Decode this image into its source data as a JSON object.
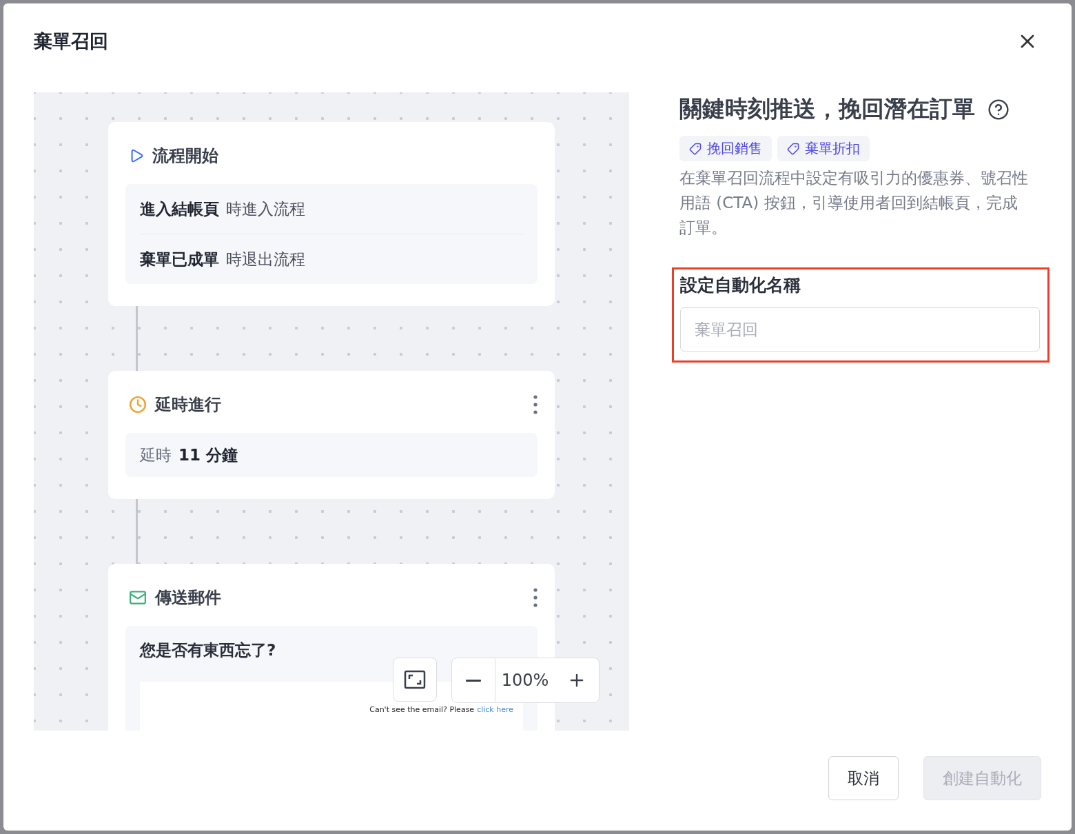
{
  "dialog": {
    "title": "棄單召回"
  },
  "flow": {
    "steps": [
      {
        "kind": "trigger",
        "title": "流程開始",
        "has_menu": false,
        "conditions": [
          {
            "bold": "進入結帳頁",
            "text": "時進入流程"
          },
          {
            "bold": "棄單已成單",
            "text": "時退出流程"
          }
        ]
      },
      {
        "kind": "delay",
        "title": "延時進行",
        "has_menu": true,
        "delay": {
          "label": "延時",
          "value": "11 分鐘"
        }
      },
      {
        "kind": "email",
        "title": "傳送郵件",
        "has_menu": true,
        "subject": "您是否有東西忘了?",
        "preview_note": "Can't see the email? Please",
        "preview_link": "click here"
      }
    ],
    "zoom": {
      "reading": "100%"
    }
  },
  "info": {
    "heading": "關鍵時刻推送，挽回潛在訂單",
    "tags": [
      "挽回銷售",
      "棄單折扣"
    ],
    "description": "在棄單召回流程中設定有吸引力的優惠券、號召性用語 (CTA) 按鈕，引導使用者回到結帳頁，完成訂單。"
  },
  "name_field": {
    "label": "設定自動化名稱",
    "placeholder": "棄單召回",
    "highlighted": true
  },
  "buttons": [
    {
      "label": "取消",
      "disabled": false
    },
    {
      "label": "創建自動化",
      "disabled": true
    }
  ]
}
